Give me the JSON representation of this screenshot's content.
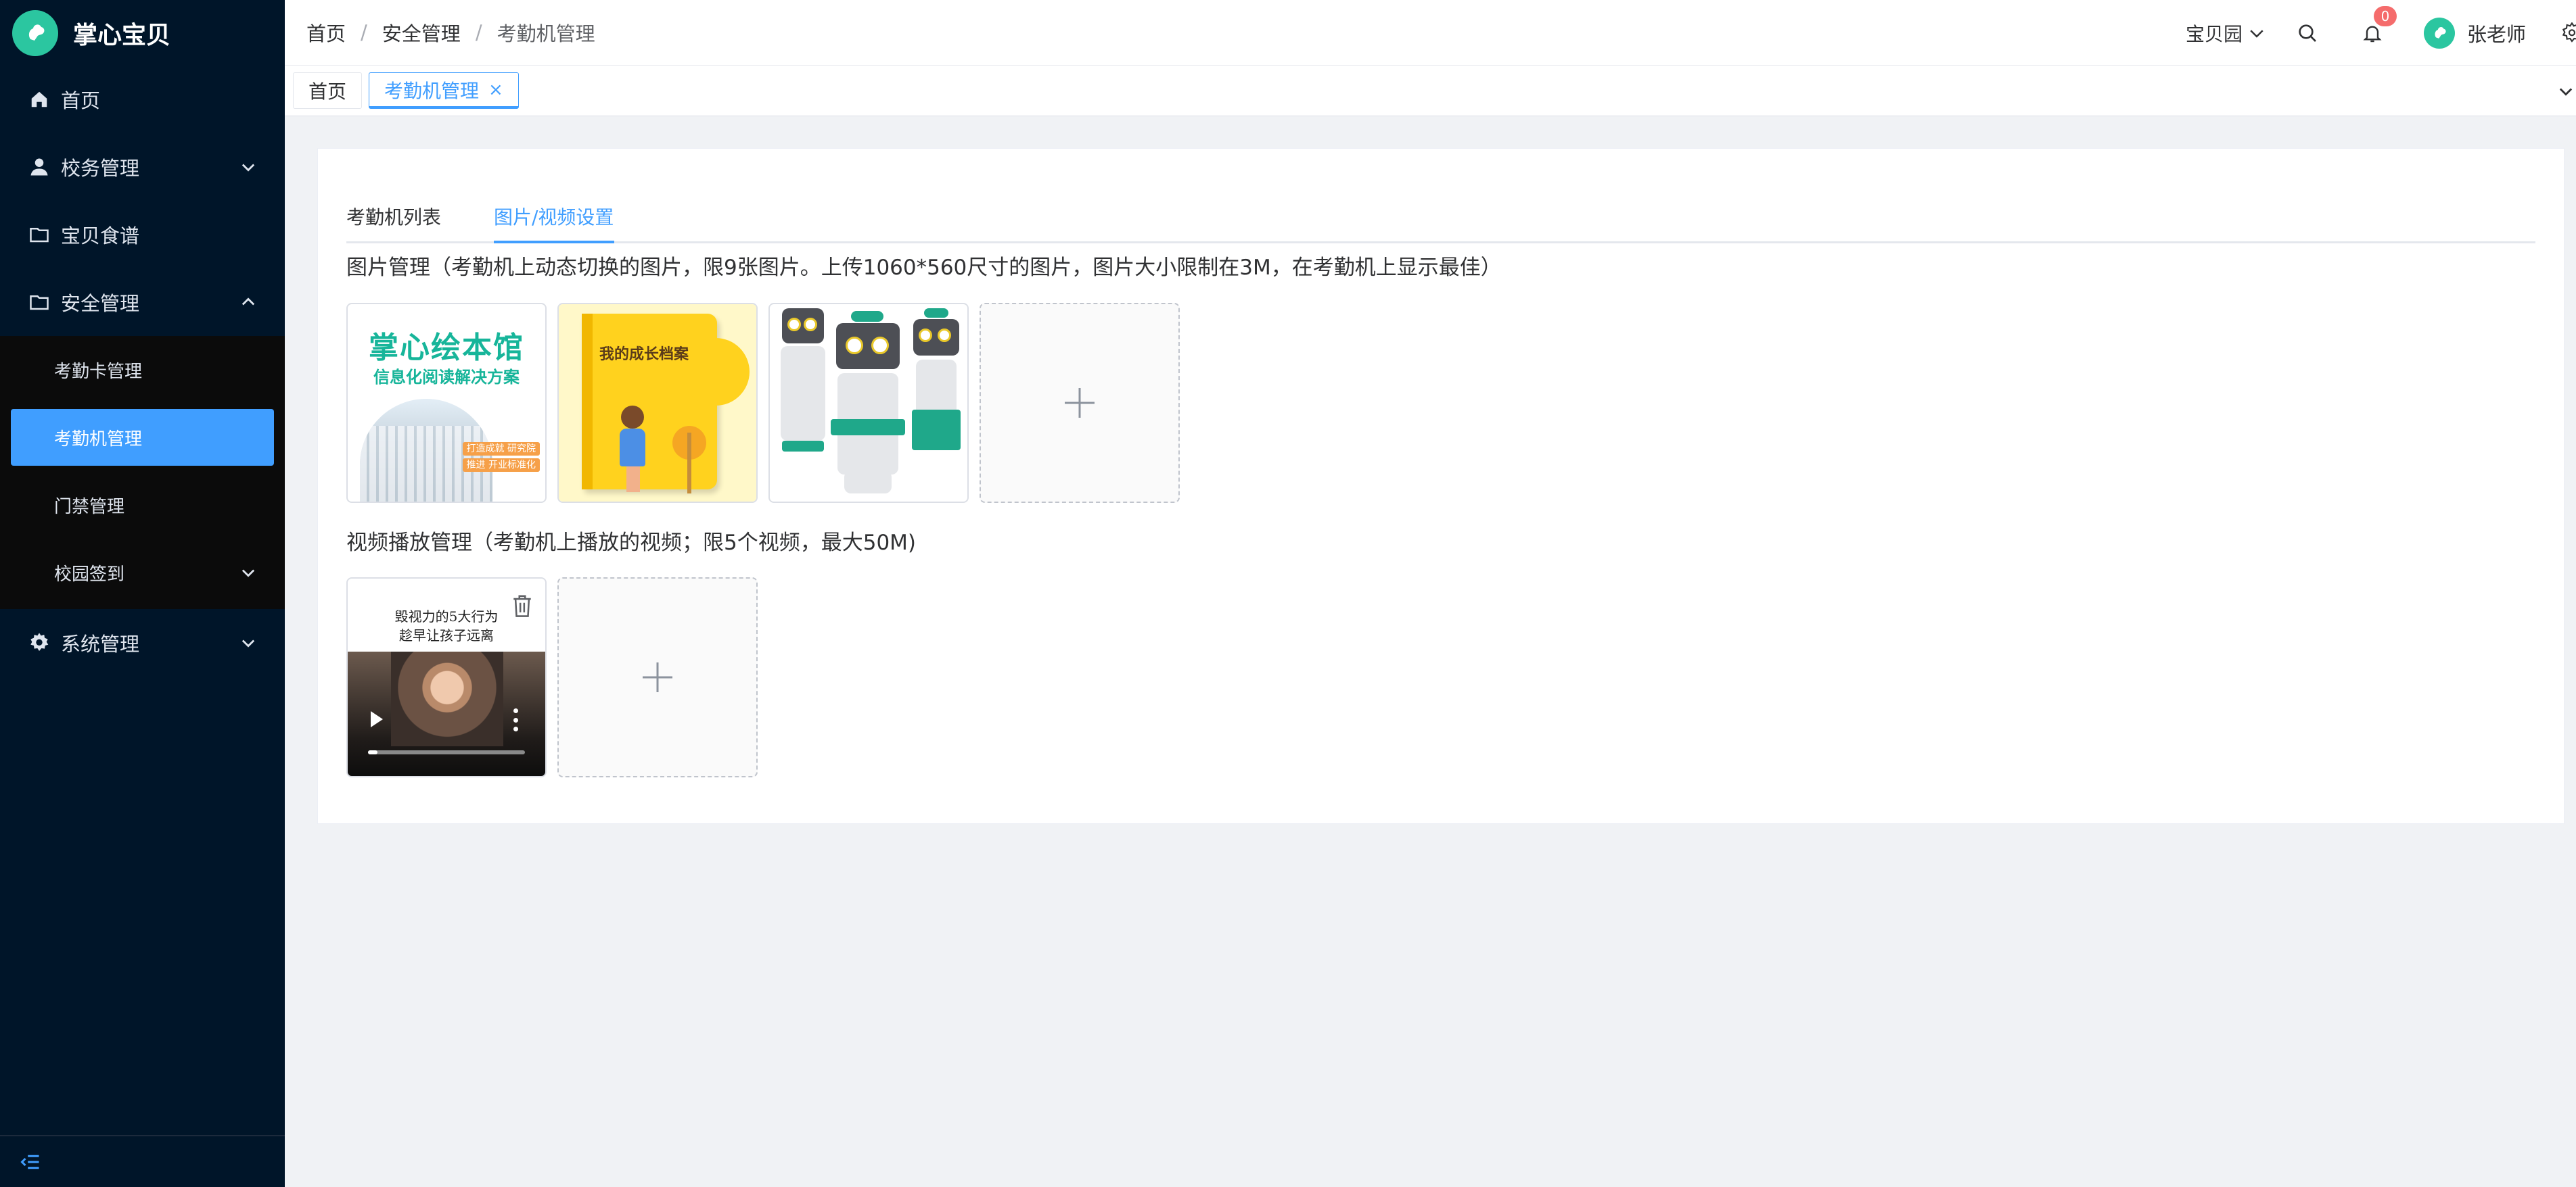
{
  "app": {
    "name": "掌心宝贝",
    "colors": {
      "sidebar_bg": "#001529",
      "accent": "#409eff",
      "badge": "#f56c6c",
      "brand": "#2bc6a0"
    }
  },
  "sidebar": {
    "items": [
      {
        "label": "首页",
        "icon": "home-icon"
      },
      {
        "label": "校务管理",
        "icon": "user-icon",
        "expandable": true
      },
      {
        "label": "宝贝食谱",
        "icon": "folder-icon"
      },
      {
        "label": "安全管理",
        "icon": "folder-icon",
        "expanded": true,
        "children": [
          {
            "label": "考勤卡管理"
          },
          {
            "label": "考勤机管理",
            "active": true
          },
          {
            "label": "门禁管理"
          },
          {
            "label": "校园签到",
            "expandable": true
          }
        ]
      },
      {
        "label": "系统管理",
        "icon": "gear-icon",
        "expandable": true
      }
    ],
    "collapse_icon": "collapse-icon"
  },
  "header": {
    "breadcrumb": [
      "首页",
      "安全管理",
      "考勤机管理"
    ],
    "breadcrumb_sep": "/",
    "school": "宝贝园",
    "notification_count": "0",
    "user_name": "张老师"
  },
  "tabs": {
    "items": [
      {
        "label": "首页"
      },
      {
        "label": "考勤机管理",
        "active": true,
        "close": "×"
      }
    ]
  },
  "page": {
    "inner_tabs": [
      "考勤机列表",
      "图片/视频设置"
    ],
    "active_inner_tab": 1,
    "image_section_title": "图片管理（考勤机上动态切换的图片，限9张图片。上传1060*560尺寸的图片，图片大小限制在3M，在考勤机上显示最佳）",
    "video_section_title": "视频播放管理（考勤机上播放的视频；限5个视频，最大50M)",
    "images": [
      {
        "title": "掌心绘本馆",
        "subtitle": "信息化阅读解决方案",
        "tags": [
          "打造成就 研究院",
          "推进 开业标准化"
        ]
      },
      {
        "title": "我的成长档案"
      },
      {
        "title": ""
      }
    ],
    "video": {
      "caption_line1": "毁视力的5大行为",
      "caption_line2": "趁早让孩子远离",
      "progress": 0.06
    }
  }
}
